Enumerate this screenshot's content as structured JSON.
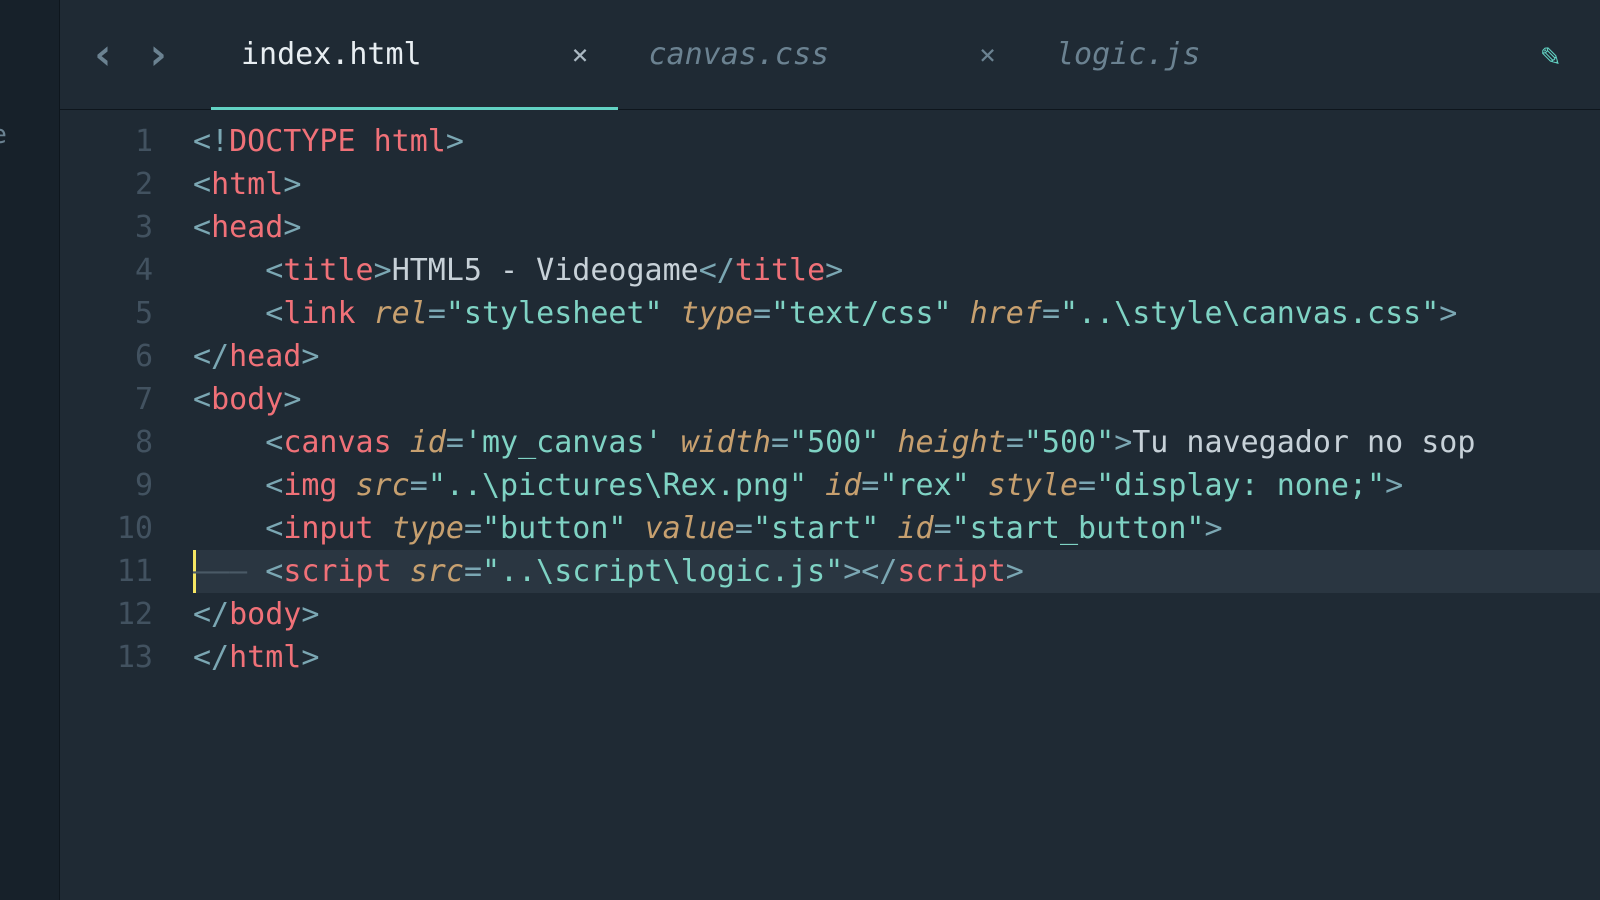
{
  "sidebar": {
    "visible_fragment": "ame"
  },
  "tabbar": {
    "nav_back": "‹",
    "nav_fwd": "›",
    "tabs": [
      {
        "label": "index.html",
        "active": true,
        "closeable": true
      },
      {
        "label": "canvas.css",
        "active": false,
        "closeable": true
      },
      {
        "label": "logic.js",
        "active": false,
        "closeable": false
      }
    ],
    "pencil_icon": "✎"
  },
  "editor": {
    "line_numbers": [
      "1",
      "2",
      "3",
      "4",
      "5",
      "6",
      "7",
      "8",
      "9",
      "10",
      "11",
      "12",
      "13"
    ],
    "highlighted_line_index": 10,
    "lines": [
      [
        {
          "c": "t-punct",
          "t": "<!"
        },
        {
          "c": "t-tag",
          "t": "DOCTYPE html"
        },
        {
          "c": "t-punct",
          "t": ">"
        }
      ],
      [
        {
          "c": "t-punct",
          "t": "<"
        },
        {
          "c": "t-tag",
          "t": "html"
        },
        {
          "c": "t-punct",
          "t": ">"
        }
      ],
      [
        {
          "c": "t-punct",
          "t": "<"
        },
        {
          "c": "t-tag",
          "t": "head"
        },
        {
          "c": "t-punct",
          "t": ">"
        }
      ],
      [
        {
          "c": "t-text",
          "t": "    "
        },
        {
          "c": "t-punct",
          "t": "<"
        },
        {
          "c": "t-tag",
          "t": "title"
        },
        {
          "c": "t-punct",
          "t": ">"
        },
        {
          "c": "t-text",
          "t": "HTML5 - Videogame"
        },
        {
          "c": "t-punct",
          "t": "</"
        },
        {
          "c": "t-tag",
          "t": "title"
        },
        {
          "c": "t-punct",
          "t": ">"
        }
      ],
      [
        {
          "c": "t-text",
          "t": "    "
        },
        {
          "c": "t-punct",
          "t": "<"
        },
        {
          "c": "t-tag",
          "t": "link"
        },
        {
          "c": "t-text",
          "t": " "
        },
        {
          "c": "t-attr",
          "t": "rel"
        },
        {
          "c": "t-punct",
          "t": "="
        },
        {
          "c": "t-str",
          "t": "\"stylesheet\""
        },
        {
          "c": "t-text",
          "t": " "
        },
        {
          "c": "t-attr",
          "t": "type"
        },
        {
          "c": "t-punct",
          "t": "="
        },
        {
          "c": "t-str",
          "t": "\"text/css\""
        },
        {
          "c": "t-text",
          "t": " "
        },
        {
          "c": "t-attr",
          "t": "href"
        },
        {
          "c": "t-punct",
          "t": "="
        },
        {
          "c": "t-str",
          "t": "\"..\\style\\canvas.css\""
        },
        {
          "c": "t-punct",
          "t": ">"
        }
      ],
      [
        {
          "c": "t-punct",
          "t": "</"
        },
        {
          "c": "t-tag",
          "t": "head"
        },
        {
          "c": "t-punct",
          "t": ">"
        }
      ],
      [
        {
          "c": "t-punct",
          "t": "<"
        },
        {
          "c": "t-tag",
          "t": "body"
        },
        {
          "c": "t-punct",
          "t": ">"
        }
      ],
      [
        {
          "c": "t-text",
          "t": "    "
        },
        {
          "c": "t-punct",
          "t": "<"
        },
        {
          "c": "t-tag",
          "t": "canvas"
        },
        {
          "c": "t-text",
          "t": " "
        },
        {
          "c": "t-attr",
          "t": "id"
        },
        {
          "c": "t-punct",
          "t": "="
        },
        {
          "c": "t-str",
          "t": "'my_canvas'"
        },
        {
          "c": "t-text",
          "t": " "
        },
        {
          "c": "t-attr",
          "t": "width"
        },
        {
          "c": "t-punct",
          "t": "="
        },
        {
          "c": "t-str",
          "t": "\"500\""
        },
        {
          "c": "t-text",
          "t": " "
        },
        {
          "c": "t-attr",
          "t": "height"
        },
        {
          "c": "t-punct",
          "t": "="
        },
        {
          "c": "t-str",
          "t": "\"500\""
        },
        {
          "c": "t-punct",
          "t": ">"
        },
        {
          "c": "t-text",
          "t": "Tu navegador no sop"
        }
      ],
      [
        {
          "c": "t-text",
          "t": "    "
        },
        {
          "c": "t-punct",
          "t": "<"
        },
        {
          "c": "t-tag",
          "t": "img"
        },
        {
          "c": "t-text",
          "t": " "
        },
        {
          "c": "t-attr",
          "t": "src"
        },
        {
          "c": "t-punct",
          "t": "="
        },
        {
          "c": "t-str",
          "t": "\"..\\pictures\\Rex.png\""
        },
        {
          "c": "t-text",
          "t": " "
        },
        {
          "c": "t-attr",
          "t": "id"
        },
        {
          "c": "t-punct",
          "t": "="
        },
        {
          "c": "t-str",
          "t": "\"rex\""
        },
        {
          "c": "t-text",
          "t": " "
        },
        {
          "c": "t-attr",
          "t": "style"
        },
        {
          "c": "t-punct",
          "t": "="
        },
        {
          "c": "t-str",
          "t": "\"display: none;\""
        },
        {
          "c": "t-punct",
          "t": ">"
        }
      ],
      [
        {
          "c": "t-text",
          "t": "    "
        },
        {
          "c": "t-punct",
          "t": "<"
        },
        {
          "c": "t-tag",
          "t": "input"
        },
        {
          "c": "t-text",
          "t": " "
        },
        {
          "c": "t-attr",
          "t": "type"
        },
        {
          "c": "t-punct",
          "t": "="
        },
        {
          "c": "t-str",
          "t": "\"button\""
        },
        {
          "c": "t-text",
          "t": " "
        },
        {
          "c": "t-attr",
          "t": "value"
        },
        {
          "c": "t-punct",
          "t": "="
        },
        {
          "c": "t-str",
          "t": "\"start\""
        },
        {
          "c": "t-text",
          "t": " "
        },
        {
          "c": "t-attr",
          "t": "id"
        },
        {
          "c": "t-punct",
          "t": "="
        },
        {
          "c": "t-str",
          "t": "\"start_button\""
        },
        {
          "c": "t-punct",
          "t": ">"
        }
      ],
      [
        {
          "c": "t-text",
          "t": "    "
        },
        {
          "c": "t-punct",
          "t": "<"
        },
        {
          "c": "t-tag",
          "t": "script"
        },
        {
          "c": "t-text",
          "t": " "
        },
        {
          "c": "t-attr",
          "t": "src"
        },
        {
          "c": "t-punct",
          "t": "="
        },
        {
          "c": "t-str",
          "t": "\"..\\script\\logic.js\""
        },
        {
          "c": "t-punct",
          "t": "></"
        },
        {
          "c": "t-tag",
          "t": "script"
        },
        {
          "c": "t-punct",
          "t": ">"
        }
      ],
      [
        {
          "c": "t-punct",
          "t": "</"
        },
        {
          "c": "t-tag",
          "t": "body"
        },
        {
          "c": "t-punct",
          "t": ">"
        }
      ],
      [
        {
          "c": "t-punct",
          "t": "</"
        },
        {
          "c": "t-tag",
          "t": "html"
        },
        {
          "c": "t-punct",
          "t": ">"
        }
      ]
    ]
  }
}
